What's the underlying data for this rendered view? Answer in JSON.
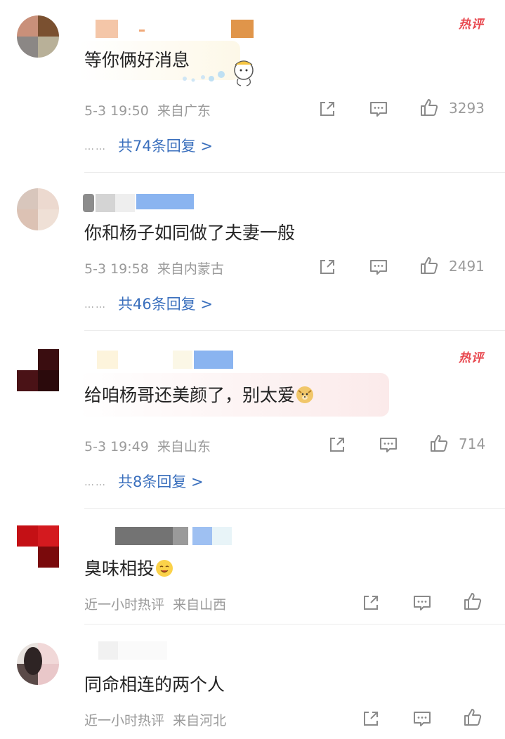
{
  "comments": [
    {
      "text": "等你俩好消息",
      "hot_badge": "热评",
      "time": "5-3 19:50",
      "location": "来自广东",
      "likes": "3293",
      "replies": "共74条回复 >",
      "replies_prefix": "……"
    },
    {
      "text": "你和杨子如同做了夫妻一般",
      "time": "5-3 19:58",
      "location": "来自内蒙古",
      "likes": "2491",
      "replies": "共46条回复 >",
      "replies_prefix": "……"
    },
    {
      "text": "给咱杨哥还美颜了，别太爱",
      "hot_badge": "热评",
      "time": "5-3 19:49",
      "location": "来自山东",
      "likes": "714",
      "replies": "共8条回复 >",
      "replies_prefix": "……"
    },
    {
      "text": "臭味相投",
      "time": "近一小时热评",
      "location": "来自山西"
    },
    {
      "text": "同命相连的两个人",
      "time": "近一小时热评",
      "location": "来自河北"
    }
  ],
  "icons": [
    "share-icon",
    "comment-icon",
    "like-icon",
    "dog-emoji-icon",
    "smile-emoji-icon",
    "mascot-sticker-icon"
  ],
  "colors": {
    "hot_badge": "#e8484f",
    "reply_link": "#3a6fbd",
    "meta": "#9a9a9a"
  }
}
